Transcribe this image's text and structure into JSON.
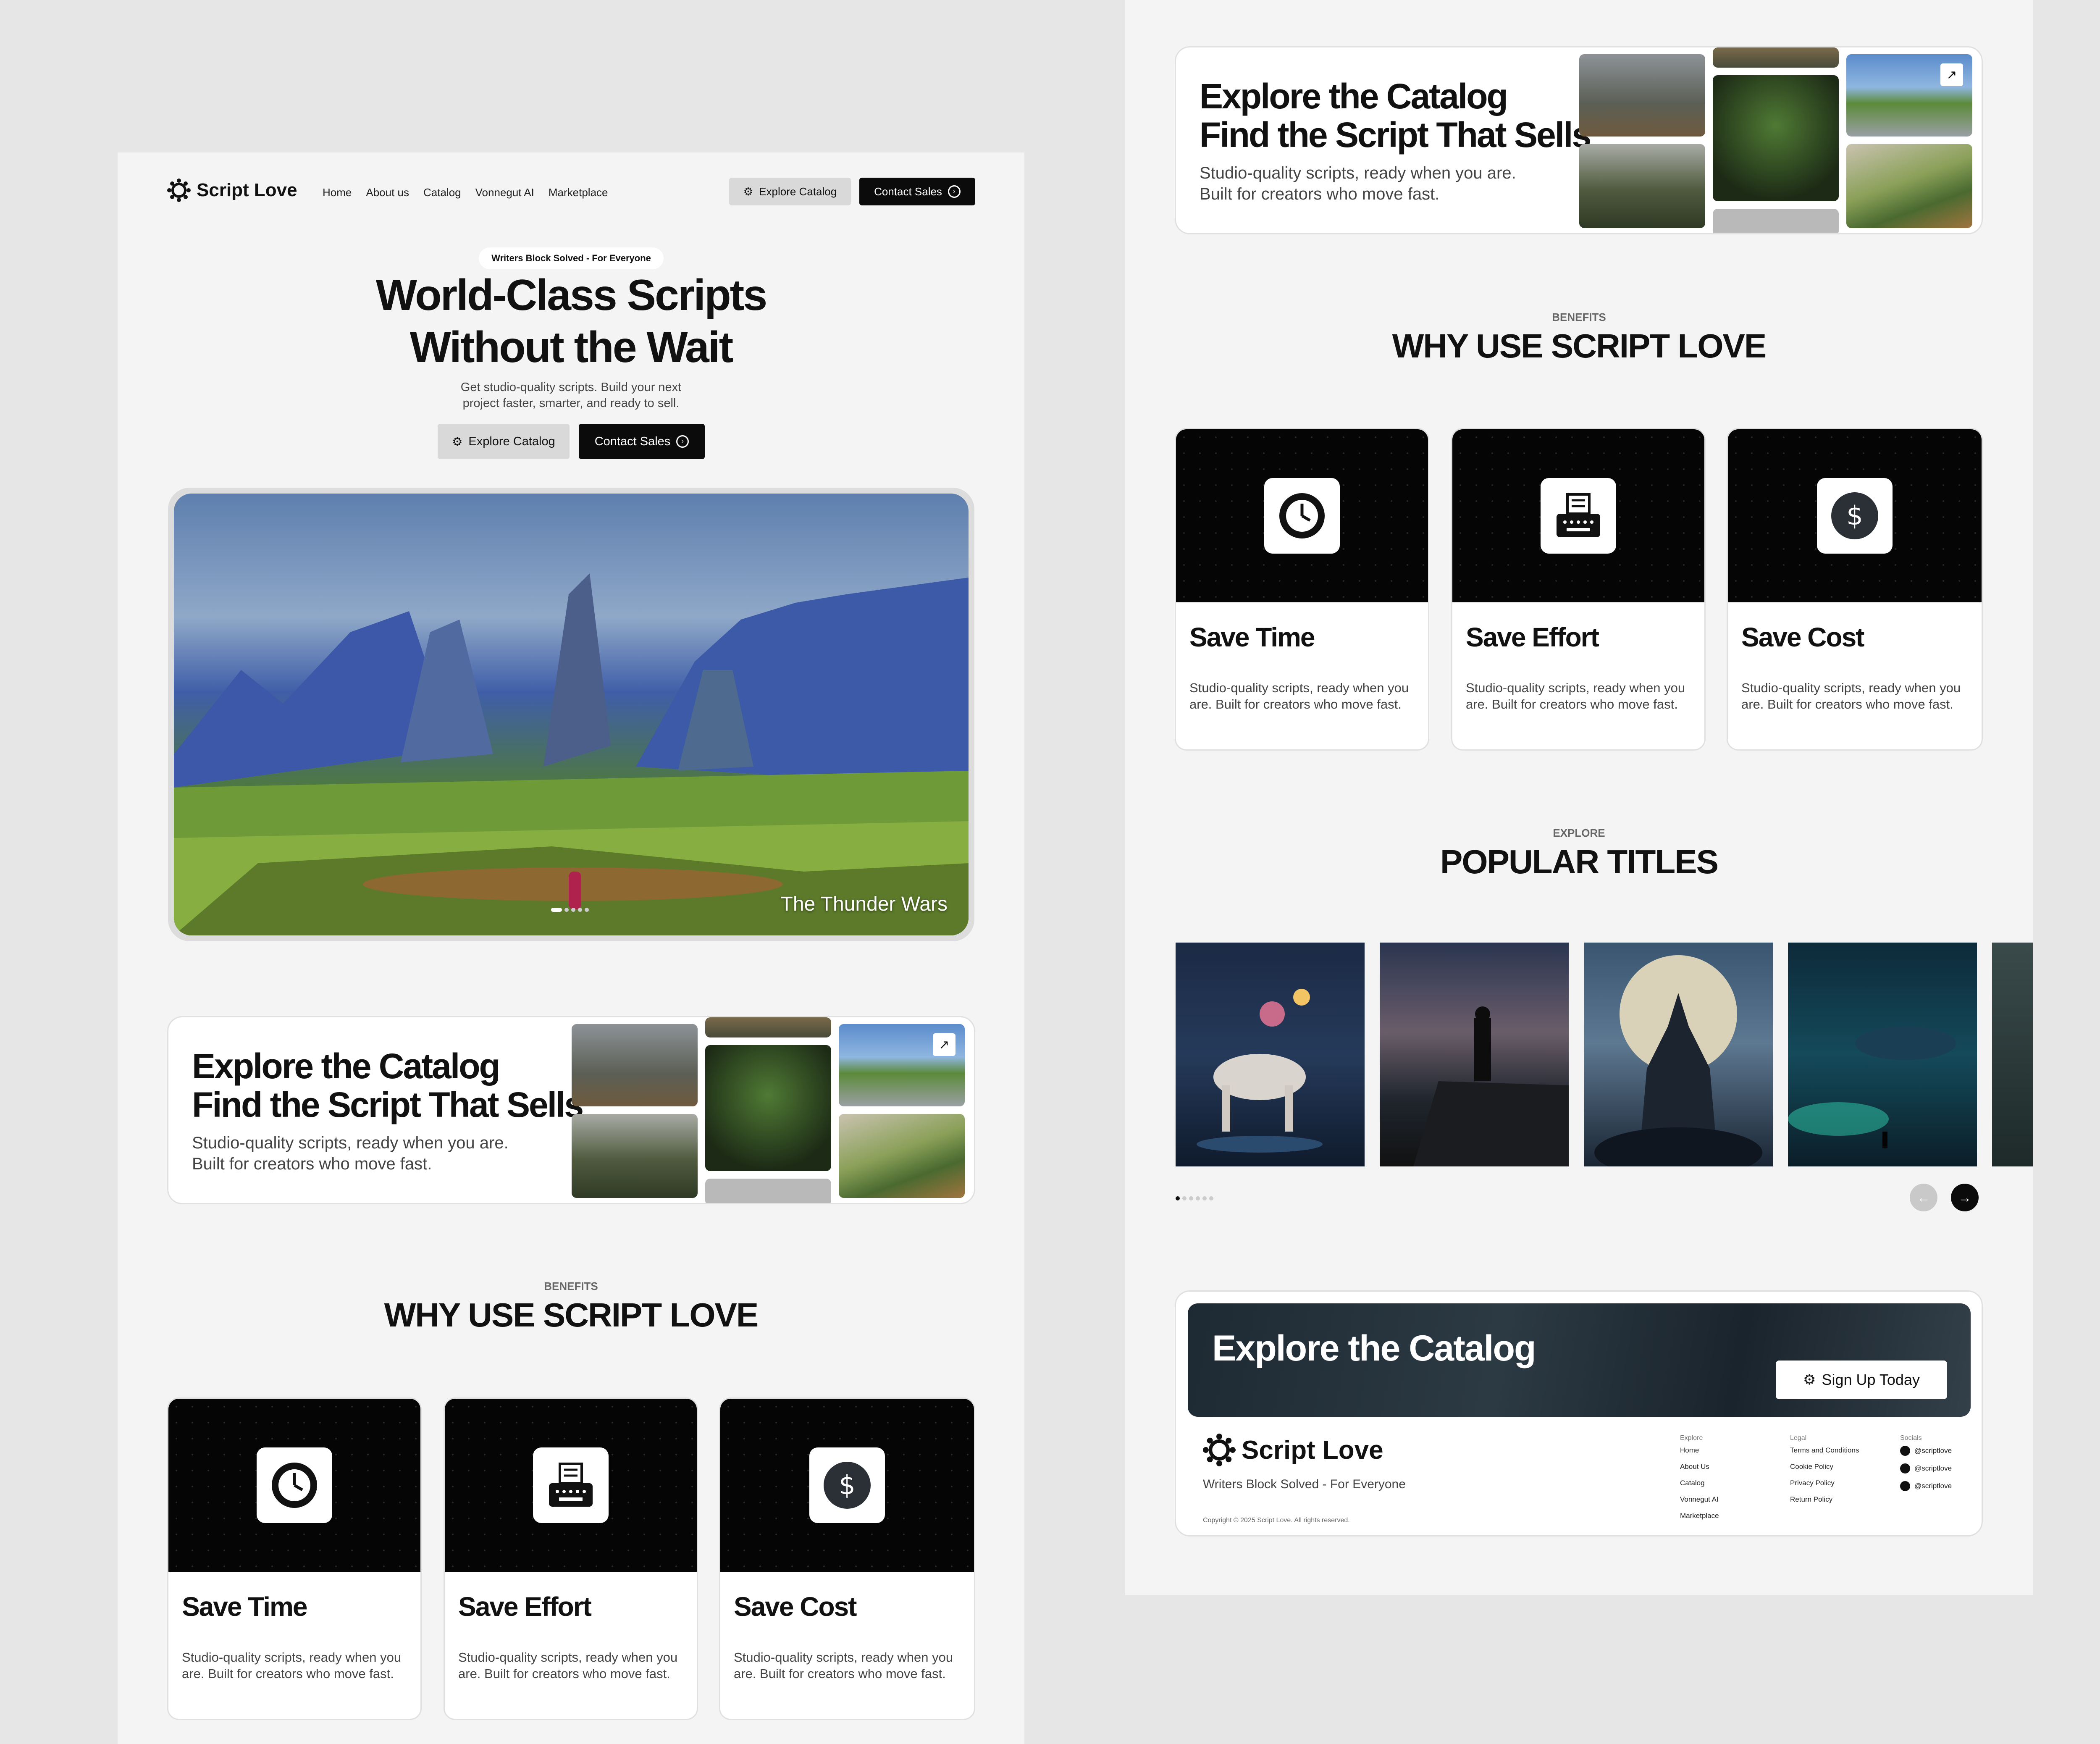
{
  "nav": {
    "brand": "Script Love",
    "links": [
      "Home",
      "About us",
      "Catalog",
      "Vonnegut AI",
      "Marketplace"
    ],
    "explore_label": "Explore Catalog",
    "contact_label": "Contact Sales"
  },
  "hero": {
    "badge": "Writers Block Solved - For Everyone",
    "title_line1": "World-Class Scripts",
    "title_line2": "Without the Wait",
    "subtitle_line1": "Get studio-quality scripts. Build your next",
    "subtitle_line2": "project faster, smarter, and ready to sell.",
    "explore_label": "Explore Catalog",
    "contact_label": "Contact Sales",
    "slide_caption": "The Thunder Wars",
    "slide_count": 5,
    "active_slide": 1
  },
  "catalog": {
    "title_line1": "Explore the Catalog",
    "title_line2": "Find the Script That Sells",
    "subtitle_line1": "Studio-quality scripts, ready when you are.",
    "subtitle_line2": "Built for creators who move fast."
  },
  "benefits": {
    "eyebrow": "BENEFITS",
    "title": "WHY USE SCRIPT LOVE",
    "cards": [
      {
        "title": "Save Time",
        "text": "Studio-quality scripts, ready when you are. Built for creators who move fast.",
        "icon": "clock-icon"
      },
      {
        "title": "Save Effort",
        "text": "Studio-quality scripts, ready when you are. Built for creators who move fast.",
        "icon": "typewriter-icon"
      },
      {
        "title": "Save Cost",
        "text": "Studio-quality scripts, ready when you are. Built for creators who move fast.",
        "icon": "dollar-icon"
      }
    ]
  },
  "popular": {
    "eyebrow": "EXPLORE",
    "title": "POPULAR TITLES",
    "posters": [
      "unicorn-poster",
      "cliff-traveler-poster",
      "moon-castle-poster",
      "underwater-whale-poster",
      "forest-poster"
    ]
  },
  "footer": {
    "banner_title": "Explore the Catalog",
    "signup_label": "Sign Up Today",
    "brand": "Script Love",
    "tagline": "Writers Block Solved - For Everyone",
    "copyright": "Copyright © 2025 Script Love. All rights reserved.",
    "explore_heading": "Explore",
    "explore_links": [
      "Home",
      "About Us",
      "Catalog",
      "Vonnegut AI",
      "Marketplace"
    ],
    "legal_heading": "Legal",
    "legal_links": [
      "Terms and Conditions",
      "Cookie Policy",
      "Privacy Policy",
      "Return Policy"
    ],
    "socials_heading": "Socials",
    "socials": [
      "@scriptlove",
      "@scriptlove",
      "@scriptlove"
    ]
  },
  "colors": {
    "background": "#e6e6e6",
    "panel": "#f4f4f4",
    "dark": "#0b0b0b",
    "light_button": "#d9d9d9"
  }
}
